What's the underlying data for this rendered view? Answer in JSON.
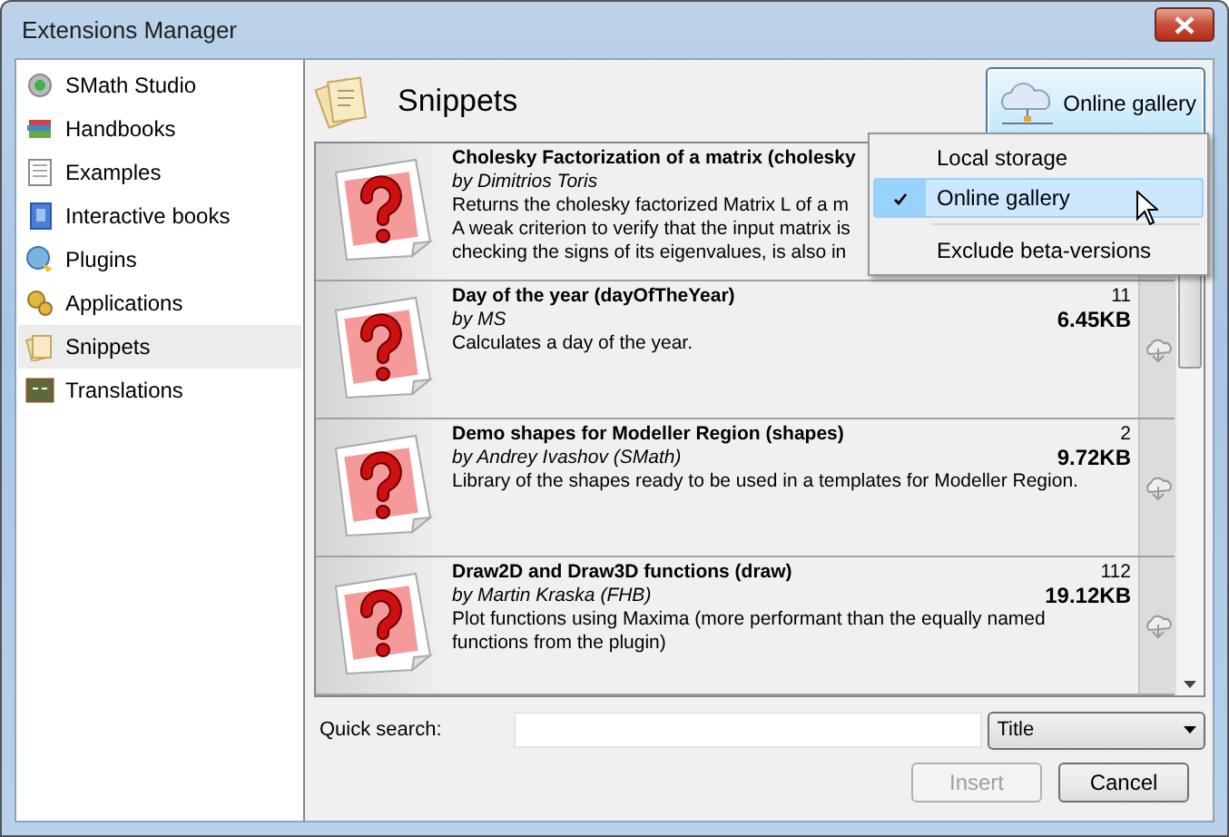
{
  "window": {
    "title": "Extensions Manager"
  },
  "sidebar": {
    "items": [
      {
        "label": "SMath Studio",
        "selected": false
      },
      {
        "label": "Handbooks",
        "selected": false
      },
      {
        "label": "Examples",
        "selected": false
      },
      {
        "label": "Interactive books",
        "selected": false
      },
      {
        "label": "Plugins",
        "selected": false
      },
      {
        "label": "Applications",
        "selected": false
      },
      {
        "label": "Snippets",
        "selected": true
      },
      {
        "label": "Translations",
        "selected": false
      }
    ]
  },
  "header": {
    "title": "Snippets",
    "source_button": "Online gallery"
  },
  "items": [
    {
      "title": "Cholesky Factorization of a matrix (cholesky",
      "author": "by Dimitrios Toris",
      "description_lines": [
        "Returns the cholesky factorized Matrix L of a m",
        "A weak criterion to verify that the input matrix is",
        "checking the signs of its eigenvalues, is also in"
      ]
    },
    {
      "title": "Day of the year (dayOfTheYear)",
      "author": "by MS",
      "description_lines": [
        "Calculates a day of the year."
      ],
      "count": "11",
      "size": "6.45KB"
    },
    {
      "title": "Demo shapes for Modeller Region (shapes)",
      "author": "by Andrey Ivashov (SMath)",
      "description_lines": [
        "Library of the shapes ready to be used in a templates for Modeller Region."
      ],
      "count": "2",
      "size": "9.72KB"
    },
    {
      "title": "Draw2D and Draw3D functions (draw)",
      "author": "by Martin Kraska  (FHB)",
      "description_lines": [
        "Plot functions using Maxima (more performant than the equally named",
        "functions from the plugin)"
      ],
      "count": "112",
      "size": "19.12KB"
    }
  ],
  "menu": {
    "items": [
      {
        "kind": "option",
        "label": "Local storage",
        "checked": false,
        "selected": false
      },
      {
        "kind": "option",
        "label": "Online gallery",
        "checked": true,
        "selected": true
      },
      {
        "kind": "separator"
      },
      {
        "kind": "option",
        "label": "Exclude beta-versions",
        "checked": false,
        "selected": false
      }
    ]
  },
  "search": {
    "label": "Quick search:",
    "filter": "Title"
  },
  "buttons": [
    {
      "label": "Insert",
      "disabled": true
    },
    {
      "label": "Cancel",
      "disabled": false
    }
  ]
}
